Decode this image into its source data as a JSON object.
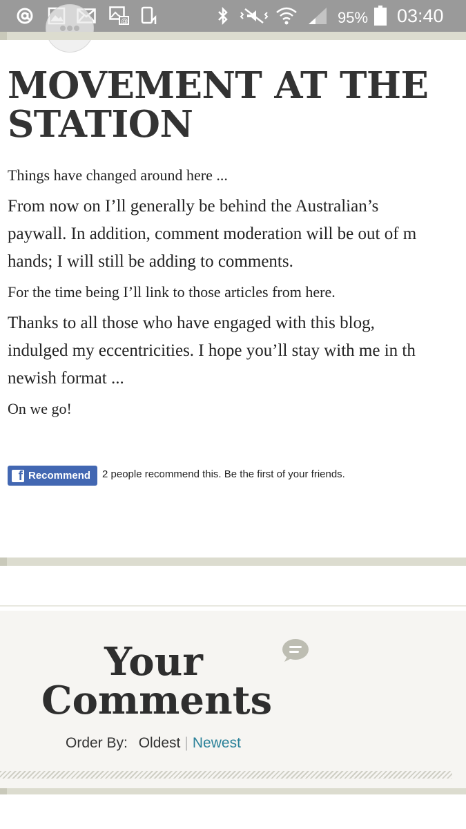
{
  "status_bar": {
    "battery_percent": "95%",
    "time": "03:40",
    "icons": [
      "at-icon",
      "image-icon",
      "mail-icon",
      "mail-image-icon",
      "phone-sync-icon",
      "bluetooth-icon",
      "vibrate-icon",
      "wifi-icon",
      "signal-icon",
      "battery-icon"
    ]
  },
  "post": {
    "title": "MOVEMENT AT THE STATION",
    "paragraphs": [
      "Things have changed around here ...",
      "From now on I’ll generally be behind the Australian’s",
      "paywall. In addition, comment moderation will be out of m",
      "hands; I will still be adding to comments.",
      "For the time being I’ll link to those articles from here.",
      "Thanks to all those who have engaged with this blog,",
      "indulged my eccentricities. I hope you’ll stay with me in th",
      "newish format ...",
      "On we go!"
    ]
  },
  "facebook": {
    "button_label": "Recommend",
    "logo_letter": "f",
    "recommend_text": "2 people recommend this. Be the first of your friends."
  },
  "comments": {
    "title_line1": "Your",
    "title_line2": "Comments",
    "order_by_label": "Order By:",
    "order_oldest": "Oldest",
    "order_separator": "|",
    "order_newest": "Newest"
  },
  "colors": {
    "status_bar": "#9a9a9a",
    "facebook_blue": "#4267b2",
    "link_active": "#2a8199",
    "band": "#dcdccf"
  }
}
